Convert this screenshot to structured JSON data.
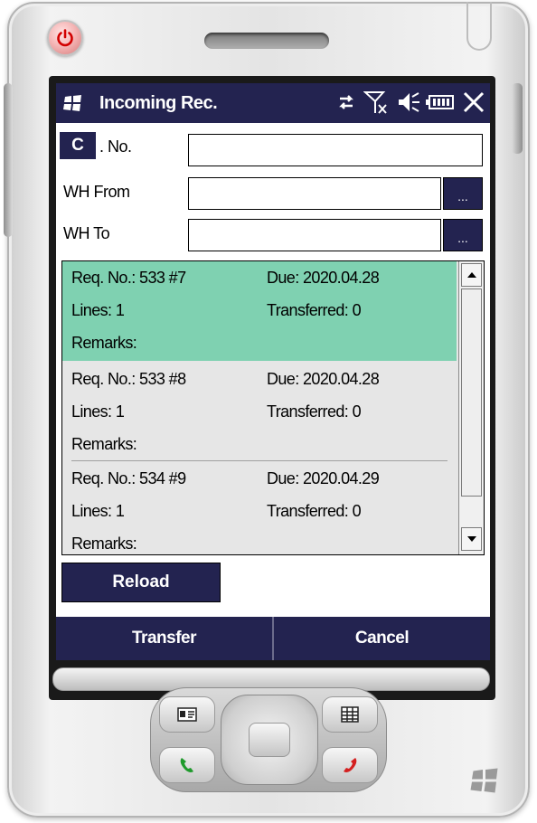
{
  "window": {
    "title": "Incoming Rec."
  },
  "status_icons": [
    "sync-arrows-icon",
    "signal-off-icon",
    "speaker-muted-icon",
    "battery-icon",
    "close-icon"
  ],
  "form": {
    "c_button": "C",
    "no_label": ". No.",
    "no_value": "",
    "wh_from_label": "WH From",
    "wh_from_value": "",
    "wh_from_lookup": "...",
    "wh_to_label": "WH To",
    "wh_to_value": "",
    "wh_to_lookup": "..."
  },
  "requests": [
    {
      "req": "Req. No.: 533 #7",
      "due": "Due: 2020.04.28",
      "lines": "Lines: 1",
      "transferred": "Transferred: 0",
      "remarks": "Remarks:",
      "selected": true
    },
    {
      "req": "Req. No.: 533 #8",
      "due": "Due: 2020.04.28",
      "lines": "Lines: 1",
      "transferred": "Transferred: 0",
      "remarks": "Remarks:",
      "selected": false
    },
    {
      "req": "Req. No.: 534 #9",
      "due": "Due: 2020.04.29",
      "lines": "Lines: 1",
      "transferred": "Transferred: 0",
      "remarks": "Remarks:",
      "selected": false
    }
  ],
  "buttons": {
    "reload": "Reload"
  },
  "softkeys": {
    "left": "Transfer",
    "right": "Cancel"
  },
  "colors": {
    "accent": "#232350",
    "selected_row": "#7fd1b1"
  }
}
